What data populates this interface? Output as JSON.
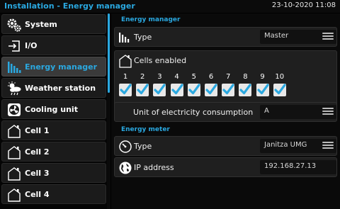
{
  "header": {
    "title": "Installation - Energy manager",
    "datetime": "23-10-2020 11:08"
  },
  "sidebar": {
    "items": [
      {
        "label": "System",
        "icon": "gears-icon"
      },
      {
        "label": "I/O",
        "icon": "io-icon"
      },
      {
        "label": "Energy manager",
        "icon": "energy-bars-icon",
        "active": true
      },
      {
        "label": "Weather station",
        "icon": "weather-icon"
      },
      {
        "label": "Cooling unit",
        "icon": "fan-icon"
      },
      {
        "label": "Cell 1",
        "icon": "house-icon"
      },
      {
        "label": "Cell 2",
        "icon": "house-icon"
      },
      {
        "label": "Cell 3",
        "icon": "house-icon"
      },
      {
        "label": "Cell 4",
        "icon": "house-icon"
      }
    ]
  },
  "energy_manager": {
    "section_title": "Energy manager",
    "type_label": "Type",
    "type_value": "Master",
    "cells_label": "Cells enabled",
    "cells": [
      {
        "number": "1",
        "checked": true
      },
      {
        "number": "2",
        "checked": true
      },
      {
        "number": "3",
        "checked": true
      },
      {
        "number": "4",
        "checked": true
      },
      {
        "number": "5",
        "checked": true
      },
      {
        "number": "6",
        "checked": true
      },
      {
        "number": "7",
        "checked": true
      },
      {
        "number": "8",
        "checked": true
      },
      {
        "number": "9",
        "checked": true
      },
      {
        "number": "10",
        "checked": true
      }
    ],
    "unit_label": "Unit of electricity consumption",
    "unit_value": "A"
  },
  "energy_meter": {
    "section_title": "Energy meter",
    "type_label": "Type",
    "type_value": "Janitza UMG",
    "ip_label": "IP address",
    "ip_value": "192.168.27.13"
  },
  "colors": {
    "accent": "#2aa8e0",
    "background": "#000000",
    "panel": "#1f1f1f"
  }
}
